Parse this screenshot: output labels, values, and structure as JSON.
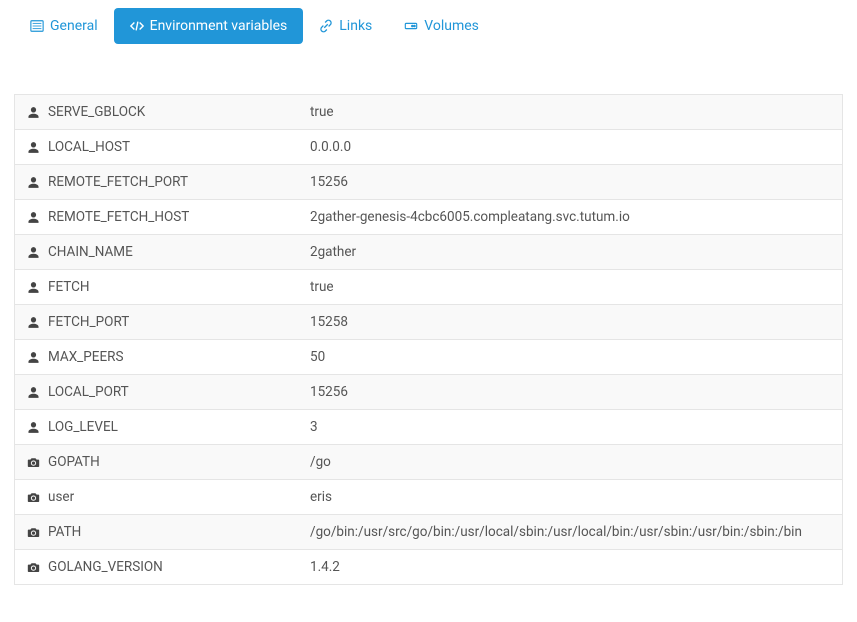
{
  "tabs": {
    "general": "General",
    "env": "Environment variables",
    "links": "Links",
    "volumes": "Volumes"
  },
  "env_vars": [
    {
      "icon": "user",
      "key": "SERVE_GBLOCK",
      "value": "true"
    },
    {
      "icon": "user",
      "key": "LOCAL_HOST",
      "value": "0.0.0.0"
    },
    {
      "icon": "user",
      "key": "REMOTE_FETCH_PORT",
      "value": "15256"
    },
    {
      "icon": "user",
      "key": "REMOTE_FETCH_HOST",
      "value": "2gather-genesis-4cbc6005.compleatang.svc.tutum.io"
    },
    {
      "icon": "user",
      "key": "CHAIN_NAME",
      "value": "2gather"
    },
    {
      "icon": "user",
      "key": "FETCH",
      "value": "true"
    },
    {
      "icon": "user",
      "key": "FETCH_PORT",
      "value": "15258"
    },
    {
      "icon": "user",
      "key": "MAX_PEERS",
      "value": "50"
    },
    {
      "icon": "user",
      "key": "LOCAL_PORT",
      "value": "15256"
    },
    {
      "icon": "user",
      "key": "LOG_LEVEL",
      "value": "3"
    },
    {
      "icon": "camera",
      "key": "GOPATH",
      "value": "/go"
    },
    {
      "icon": "camera",
      "key": "user",
      "value": "eris"
    },
    {
      "icon": "camera",
      "key": "PATH",
      "value": "/go/bin:/usr/src/go/bin:/usr/local/sbin:/usr/local/bin:/usr/sbin:/usr/bin:/sbin:/bin"
    },
    {
      "icon": "camera",
      "key": "GOLANG_VERSION",
      "value": "1.4.2"
    }
  ]
}
